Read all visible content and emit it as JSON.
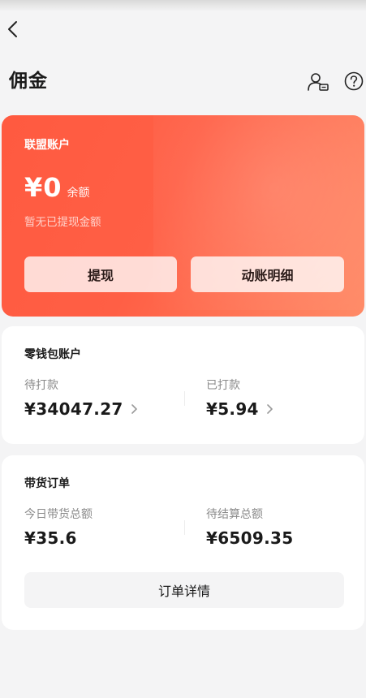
{
  "header": {
    "title": "佣金",
    "back_icon": "back-arrow-icon",
    "user_icon": "user-card-icon",
    "help_icon": "help-circle-icon"
  },
  "alliance": {
    "label": "联盟账户",
    "amount": "¥0",
    "amount_unit": "余额",
    "no_withdraw_text": "暂无已提现金额",
    "withdraw_button": "提现",
    "detail_button": "动账明细",
    "gradient_colors": [
      "#ff5a40",
      "#ff8a66"
    ]
  },
  "wallet": {
    "title": "零钱包账户",
    "pending_label": "待打款",
    "pending_value": "¥34047.27",
    "paid_label": "已打款",
    "paid_value": "¥5.94"
  },
  "orders": {
    "title": "带货订单",
    "today_label": "今日带货总额",
    "today_value": "¥35.6",
    "settle_label": "待结算总额",
    "settle_value": "¥6509.35",
    "details_button": "订单详情"
  }
}
